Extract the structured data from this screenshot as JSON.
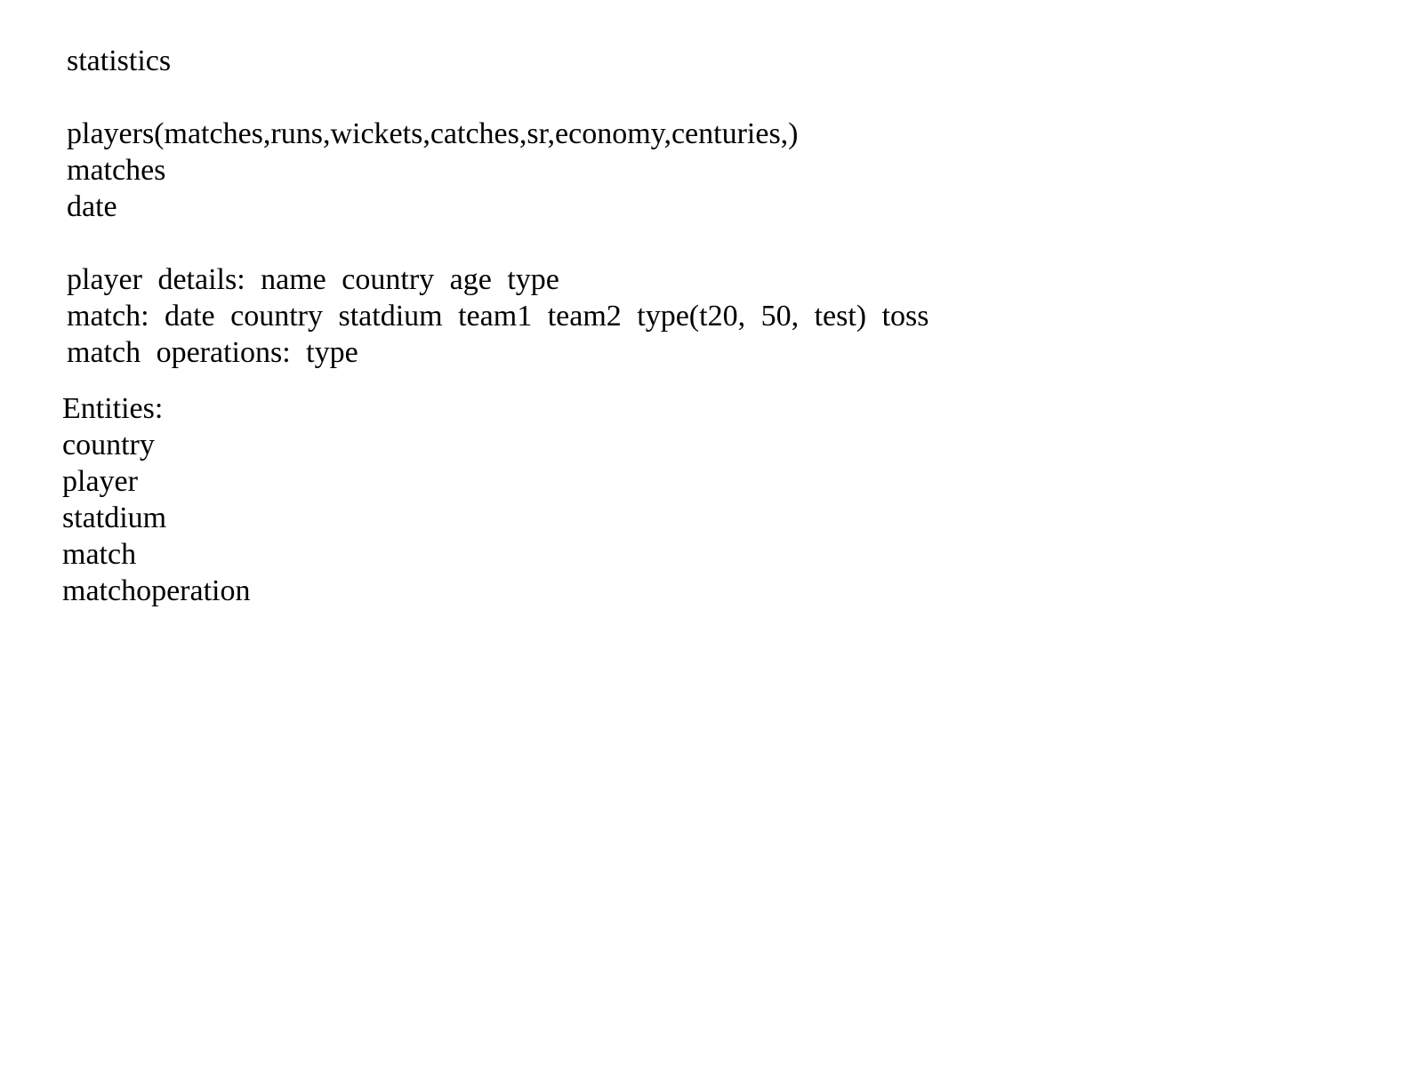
{
  "notes": {
    "heading": "statistics",
    "stats_lines": [
      "players(matches,runs,wickets,catches,sr,economy,centuries,)",
      "matches",
      "date"
    ],
    "detail_lines": [
      "player details: name country age type",
      "match: date country statdium team1 team2 type(t20, 50, test) toss",
      "match operations: type"
    ]
  },
  "entities": {
    "heading": "Entities:",
    "items": [
      "country",
      "player",
      "statdium",
      "match",
      "matchoperation"
    ]
  }
}
